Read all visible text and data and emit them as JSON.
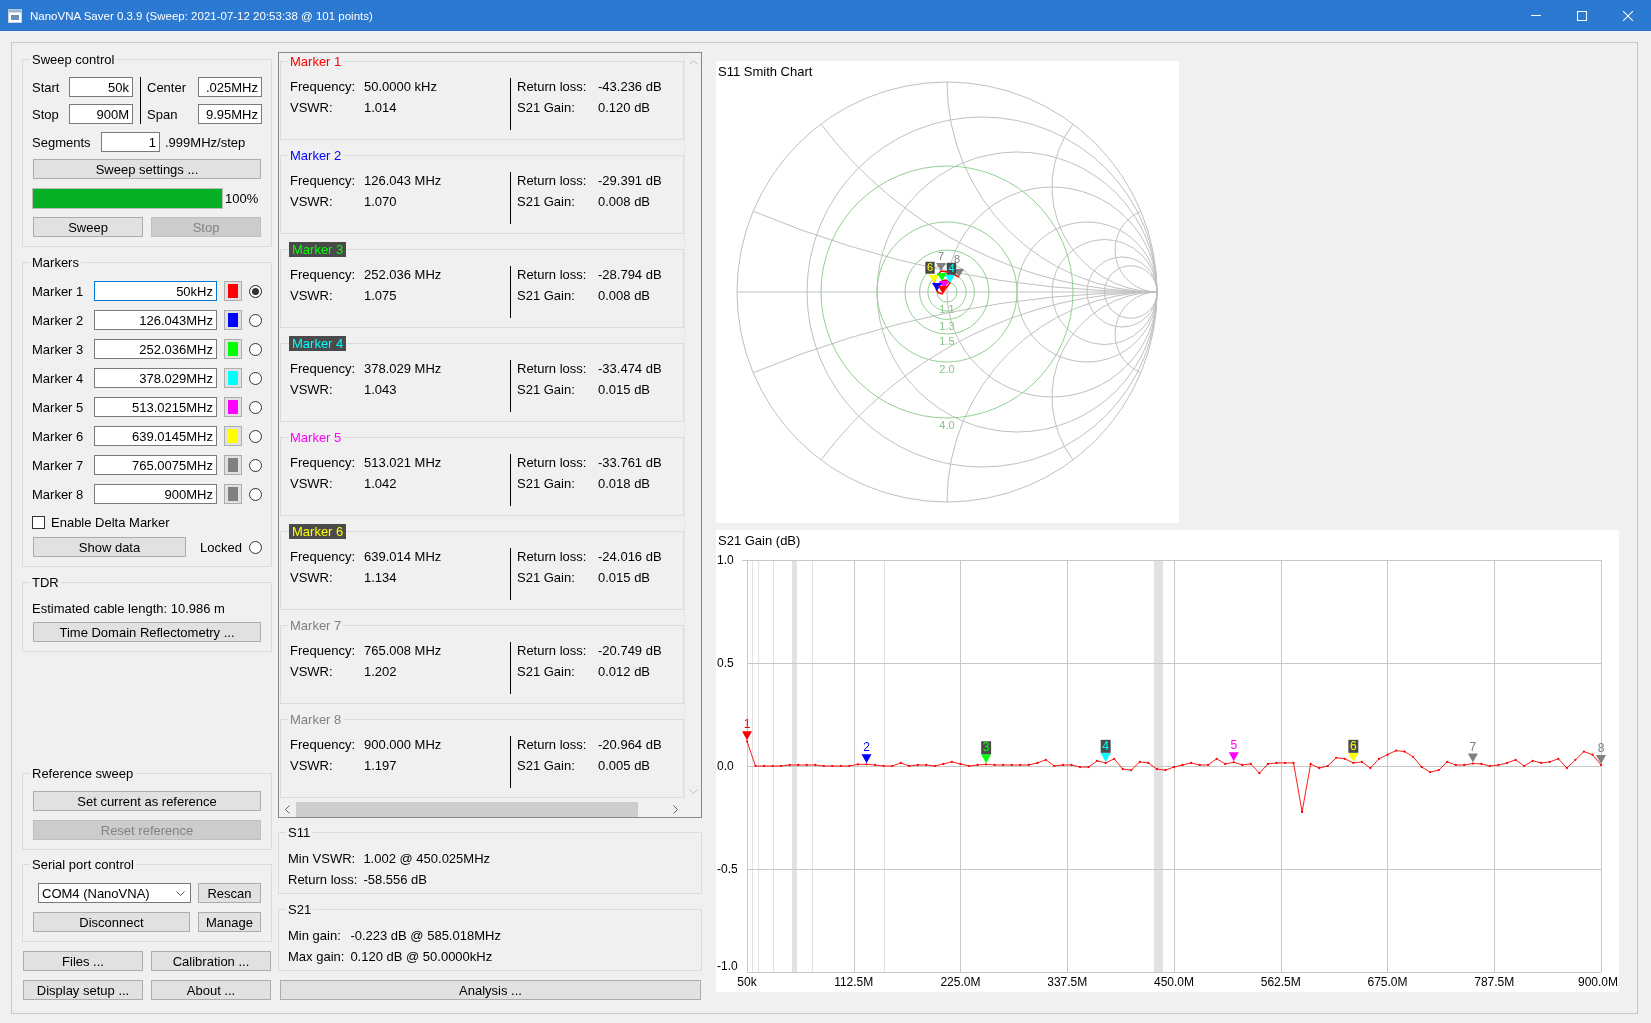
{
  "window": {
    "title": "NanoVNA Saver 0.3.9 (Sweep: 2021-07-12 20:53:38 @ 101 points)"
  },
  "sweep_control": {
    "title": "Sweep control",
    "left_fields": [
      {
        "label": "Start",
        "value": "50k"
      },
      {
        "label": "Stop",
        "value": "900M"
      }
    ],
    "right_fields": [
      {
        "label": "Center",
        "value": ".025MHz"
      },
      {
        "label": "Span",
        "value": "9.95MHz"
      }
    ],
    "segments": {
      "label": "Segments",
      "value": "1",
      "step": ".999MHz/step"
    },
    "settings_button": "Sweep settings ...",
    "progress": {
      "level": 1.0,
      "text": "100%"
    },
    "buttons": [
      {
        "label": "Sweep",
        "disabled": false
      },
      {
        "label": "Stop",
        "disabled": true
      }
    ]
  },
  "markers": {
    "title": "Markers",
    "items": [
      {
        "label": "Marker 1",
        "value": "50kHz",
        "focused": true,
        "color": "#ff0000",
        "selected": true
      },
      {
        "label": "Marker 2",
        "value": "126.043MHz",
        "focused": false,
        "color": "#0000ff",
        "selected": false
      },
      {
        "label": "Marker 3",
        "value": "252.036MHz",
        "focused": false,
        "color": "#00ff00",
        "selected": false
      },
      {
        "label": "Marker 4",
        "value": "378.029MHz",
        "focused": false,
        "color": "#00ffff",
        "selected": false
      },
      {
        "label": "Marker 5",
        "value": "513.0215MHz",
        "focused": false,
        "color": "#ff00ff",
        "selected": false
      },
      {
        "label": "Marker 6",
        "value": "639.0145MHz",
        "focused": false,
        "color": "#ffff00",
        "selected": false
      },
      {
        "label": "Marker 7",
        "value": "765.0075MHz",
        "focused": false,
        "color": "#808080",
        "selected": false
      },
      {
        "label": "Marker 8",
        "value": "900MHz",
        "focused": false,
        "color": "#808080",
        "selected": false
      }
    ],
    "delta": {
      "label": "Enable Delta Marker",
      "checked": false
    },
    "show_data_button": "Show data",
    "locked": {
      "label": "Locked",
      "selected": false
    }
  },
  "tdr": {
    "title": "TDR",
    "text": "Estimated cable length: 10.986 m",
    "button": "Time Domain Reflectometry ..."
  },
  "reference_sweep": {
    "title": "Reference sweep",
    "buttons": [
      {
        "label": "Set current as reference",
        "disabled": false
      },
      {
        "label": "Reset reference",
        "disabled": true
      }
    ]
  },
  "serial_port": {
    "title": "Serial port control",
    "port": "COM4 (NanoVNA)",
    "rescan_button": "Rescan",
    "disconnect_button": "Disconnect",
    "manage_button": "Manage"
  },
  "bottom_buttons": [
    "Files ...",
    "Calibration ...",
    "Display setup ...",
    "About ..."
  ],
  "marker_details": [
    {
      "title": "Marker 1",
      "left": [
        {
          "label": "Frequency:",
          "value": "50.0000 kHz"
        },
        {
          "label": "VSWR:",
          "value": "1.014"
        }
      ],
      "right": [
        {
          "label": "Return loss:",
          "value": "-43.236 dB"
        },
        {
          "label": "S21 Gain:",
          "value": "0.120 dB"
        }
      ]
    },
    {
      "title": "Marker 2",
      "left": [
        {
          "label": "Frequency:",
          "value": "126.043 MHz"
        },
        {
          "label": "VSWR:",
          "value": "1.070"
        }
      ],
      "right": [
        {
          "label": "Return loss:",
          "value": "-29.391 dB"
        },
        {
          "label": "S21 Gain:",
          "value": "0.008 dB"
        }
      ]
    },
    {
      "title": "Marker 3",
      "left": [
        {
          "label": "Frequency:",
          "value": "252.036 MHz"
        },
        {
          "label": "VSWR:",
          "value": "1.075"
        }
      ],
      "right": [
        {
          "label": "Return loss:",
          "value": "-28.794 dB"
        },
        {
          "label": "S21 Gain:",
          "value": "0.008 dB"
        }
      ]
    },
    {
      "title": "Marker 4",
      "left": [
        {
          "label": "Frequency:",
          "value": "378.029 MHz"
        },
        {
          "label": "VSWR:",
          "value": "1.043"
        }
      ],
      "right": [
        {
          "label": "Return loss:",
          "value": "-33.474 dB"
        },
        {
          "label": "S21 Gain:",
          "value": "0.015 dB"
        }
      ]
    },
    {
      "title": "Marker 5",
      "left": [
        {
          "label": "Frequency:",
          "value": "513.021 MHz"
        },
        {
          "label": "VSWR:",
          "value": "1.042"
        }
      ],
      "right": [
        {
          "label": "Return loss:",
          "value": "-33.761 dB"
        },
        {
          "label": "S21 Gain:",
          "value": "0.018 dB"
        }
      ]
    },
    {
      "title": "Marker 6",
      "left": [
        {
          "label": "Frequency:",
          "value": "639.014 MHz"
        },
        {
          "label": "VSWR:",
          "value": "1.134"
        }
      ],
      "right": [
        {
          "label": "Return loss:",
          "value": "-24.016 dB"
        },
        {
          "label": "S21 Gain:",
          "value": "0.015 dB"
        }
      ]
    },
    {
      "title": "Marker 7",
      "left": [
        {
          "label": "Frequency:",
          "value": "765.008 MHz"
        },
        {
          "label": "VSWR:",
          "value": "1.202"
        }
      ],
      "right": [
        {
          "label": "Return loss:",
          "value": "-20.749 dB"
        },
        {
          "label": "S21 Gain:",
          "value": "0.012 dB"
        }
      ]
    },
    {
      "title": "Marker 8",
      "left": [
        {
          "label": "Frequency:",
          "value": "900.000 MHz"
        },
        {
          "label": "VSWR:",
          "value": "1.197"
        }
      ],
      "right": [
        {
          "label": "Return loss:",
          "value": "-20.964 dB"
        },
        {
          "label": "S21 Gain:",
          "value": "0.005 dB"
        }
      ]
    }
  ],
  "s11_summary": {
    "title": "S11",
    "rows": [
      {
        "label": "Min VSWR:",
        "value": "1.002 @ 450.025MHz"
      },
      {
        "label": "Return loss:",
        "value": "-58.556 dB"
      }
    ]
  },
  "s21_summary": {
    "title": "S21",
    "rows": [
      {
        "label": "Min gain:",
        "value": "-0.223 dB @ 585.018MHz"
      },
      {
        "label": "Max gain:",
        "value": "0.120 dB @ 50.0000kHz"
      }
    ]
  },
  "analysis_button": "Analysis ...",
  "smith_chart": {
    "title": "S11 Smith Chart",
    "vswr_labels": [
      "1.1",
      "1.3",
      "1.5",
      "2.0",
      "4.0"
    ],
    "markers": [
      {
        "label": "7",
        "color": "#808080"
      },
      {
        "label": "8",
        "color": "#808080"
      },
      {
        "label": "6",
        "color": "#ffff00"
      },
      {
        "label": "4",
        "color": "#00ffff"
      },
      {
        "color": "#00ff00"
      },
      {
        "color": "#ff00ff"
      },
      {
        "color": "#0000ff"
      },
      {
        "color": "#ff0000"
      }
    ]
  },
  "s21_chart": {
    "chart_data": {
      "type": "line",
      "title": "S21 Gain (dB)",
      "grid": true,
      "x": [
        50000,
        9000000,
        18000000,
        27000000,
        36000000,
        45000000,
        54000000,
        63000000,
        72000000,
        81000000,
        90000000,
        99000000,
        108000000,
        117000000,
        126000000,
        135000000,
        144000000,
        153000000,
        162000000,
        171000000,
        180000000,
        189000000,
        198000000,
        207000000,
        216000000,
        225000000,
        234000000,
        243000000,
        252000000,
        261000000,
        270000000,
        279000000,
        288000000,
        297000000,
        306000000,
        315000000,
        324000000,
        333000000,
        342000000,
        351000000,
        360000000,
        369000000,
        378000000,
        387000000,
        396000000,
        405000000,
        414000000,
        423000000,
        432000000,
        441000000,
        450000000,
        459000000,
        468000000,
        477000000,
        486000000,
        495000000,
        504000000,
        513000000,
        522000000,
        531000000,
        540000000,
        549000000,
        558000000,
        567000000,
        576000000,
        585000000,
        594000000,
        603000000,
        612000000,
        621000000,
        630000000,
        639000000,
        648000000,
        657000000,
        666000000,
        675000000,
        684000000,
        693000000,
        702000000,
        711000000,
        720000000,
        729000000,
        738000000,
        747000000,
        756000000,
        765000000,
        774000000,
        783000000,
        792000000,
        801000000,
        810000000,
        819000000,
        828000000,
        837000000,
        846000000,
        855000000,
        864000000,
        873000000,
        882000000,
        891000000,
        900000000
      ],
      "series": [
        {
          "color": "#ff0000",
          "values": [
            0.12,
            0,
            0,
            0,
            0,
            0.005,
            0.005,
            0.005,
            0.005,
            0,
            0,
            0,
            0,
            0.008,
            0.008,
            0.005,
            0,
            0,
            0.015,
            0,
            0.005,
            0.005,
            0,
            0.01,
            0.02,
            0.01,
            0,
            0.005,
            0.008,
            0.005,
            0.005,
            0.005,
            0.005,
            0.005,
            0.015,
            0.03,
            0,
            0.005,
            0.005,
            -0.005,
            -0.005,
            0.025,
            0.015,
            0.035,
            -0.015,
            -0.02,
            0.02,
            0.015,
            -0.015,
            -0.02,
            -0.005,
            0.005,
            0.015,
            0.005,
            0.005,
            0.035,
            0.01,
            0.018,
            0.005,
            0.01,
            -0.035,
            0.01,
            0.015,
            0.015,
            0.015,
            -0.223,
            0.01,
            -0.01,
            0,
            0.04,
            0.035,
            0.015,
            0.02,
            -0.01,
            0.035,
            0.055,
            0.075,
            0.07,
            0.045,
            -0.005,
            -0.03,
            -0.02,
            0.02,
            0.005,
            0.005,
            0.012,
            0.01,
            0,
            0.005,
            0.015,
            0.03,
            0,
            0.025,
            0.015,
            0.02,
            0.035,
            -0.01,
            0.03,
            0.07,
            0.055,
            0.005
          ]
        }
      ],
      "xlim": [
        50000,
        900000000
      ],
      "ylim": [
        -1,
        1
      ],
      "xticks": [
        {
          "value": 50000,
          "label": "50k"
        },
        {
          "value": 112500000,
          "label": "112.5M"
        },
        {
          "value": 225000000,
          "label": "225.0M"
        },
        {
          "value": 337500000,
          "label": "337.5M"
        },
        {
          "value": 450000000,
          "label": "450.0M"
        },
        {
          "value": 562500000,
          "label": "562.5M"
        },
        {
          "value": 675000000,
          "label": "675.0M"
        },
        {
          "value": 787500000,
          "label": "787.5M"
        },
        {
          "value": 900000000,
          "label": "900.0M"
        }
      ],
      "yticks": [
        {
          "value": 1,
          "label": "1.0"
        },
        {
          "value": 0.5,
          "label": "0.5"
        },
        {
          "value": 0,
          "label": "0.0"
        },
        {
          "value": -0.5,
          "label": "-0.5"
        },
        {
          "value": -1,
          "label": "-1.0"
        }
      ],
      "annotations": [
        {
          "text": "1",
          "x": 50000,
          "y": 0.12
        },
        {
          "text": "2",
          "x": 126043000,
          "y": 0.008
        },
        {
          "text": "3",
          "x": 252036000,
          "y": 0.008
        },
        {
          "text": "4",
          "x": 378029000,
          "y": 0.015
        },
        {
          "text": "5",
          "x": 513021000,
          "y": 0.018
        },
        {
          "text": "6",
          "x": 639014000,
          "y": 0.015
        },
        {
          "text": "7",
          "x": 765008000,
          "y": 0.012
        },
        {
          "text": "8",
          "x": 900000000,
          "y": 0.005
        }
      ]
    }
  }
}
